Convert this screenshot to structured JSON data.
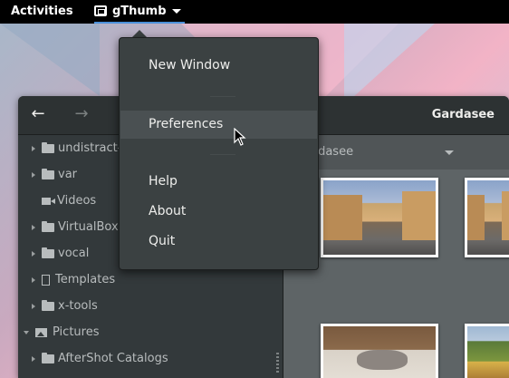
{
  "topbar": {
    "activities_label": "Activities",
    "app_label": "gThumb"
  },
  "window": {
    "title": "Gardasee",
    "back_icon": "←",
    "forward_icon": "→"
  },
  "sidebar": {
    "items": [
      {
        "label": "undistract-",
        "icon": "folder-icon"
      },
      {
        "label": "var",
        "icon": "folder-icon"
      },
      {
        "label": "Videos",
        "icon": "video-icon"
      },
      {
        "label": "VirtualBox",
        "icon": "folder-icon"
      },
      {
        "label": "vocal",
        "icon": "folder-icon"
      },
      {
        "label": "Templates",
        "icon": "document-icon"
      },
      {
        "label": "x-tools",
        "icon": "folder-icon"
      },
      {
        "label": "Pictures",
        "icon": "pictures-icon"
      },
      {
        "label": "AfterShot Catalogs",
        "icon": "folder-icon"
      }
    ]
  },
  "location": {
    "label": "ardasee"
  },
  "menu": {
    "items": [
      "New Window",
      "Preferences",
      "Help",
      "About",
      "Quit"
    ],
    "hovered": "Preferences"
  },
  "colors": {
    "accent": "#4a90d9",
    "menu_bg": "#3b4142",
    "window_bg": "#393f3f"
  }
}
